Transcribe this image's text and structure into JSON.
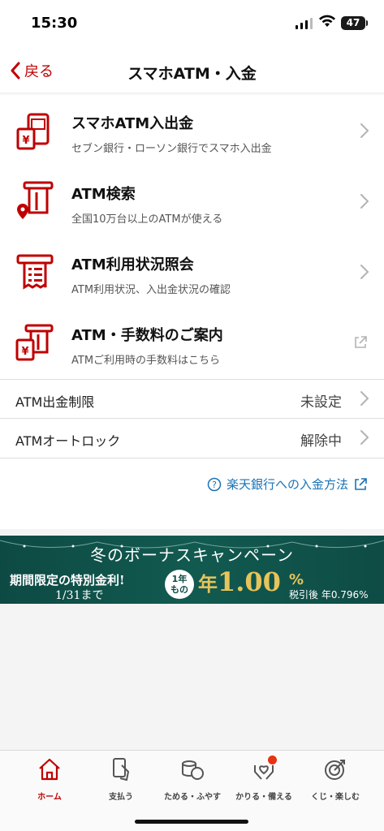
{
  "status_bar": {
    "time": "15:30",
    "battery": "47"
  },
  "nav": {
    "back_label": "戻る",
    "title": "スマホATM・入金"
  },
  "menu": [
    {
      "title": "スマホATM入出金",
      "subtitle": "セブン銀行・ローソン銀行でスマホ入出金",
      "icon": "smartphone-atm-icon",
      "trailing": "chevron"
    },
    {
      "title": "ATM検索",
      "subtitle": "全国10万台以上のATMが使える",
      "icon": "atm-location-icon",
      "trailing": "chevron"
    },
    {
      "title": "ATM利用状況照会",
      "subtitle": "ATM利用状況、入出金状況の確認",
      "icon": "atm-receipt-icon",
      "trailing": "chevron"
    },
    {
      "title": "ATM・手数料のご案内",
      "subtitle": "ATMご利用時の手数料はこちら",
      "icon": "atm-yen-icon",
      "trailing": "external"
    }
  ],
  "settings": [
    {
      "label": "ATM出金制限",
      "value": "未設定"
    },
    {
      "label": "ATMオートロック",
      "value": "解除中"
    }
  ],
  "deposit_link": "楽天銀行への入金方法",
  "banner": {
    "title": "冬のボーナスキャンペーン",
    "left_line1": "期間限定の特別金利!",
    "left_line2": "1/31まで",
    "badge_line1": "1年",
    "badge_line2": "もの",
    "rate_prefix": "年",
    "rate_value": "1.00",
    "rate_pct": "%",
    "net_rate": "税引後 年0.796%"
  },
  "tabs": [
    {
      "label": "ホーム",
      "icon": "home-icon",
      "active": true
    },
    {
      "label": "支払う",
      "icon": "card-payment-icon",
      "active": false
    },
    {
      "label": "ためる・ふやす",
      "icon": "coins-icon",
      "active": false
    },
    {
      "label": "かりる・備える",
      "icon": "hands-heart-icon",
      "active": false,
      "badge": true
    },
    {
      "label": "くじ・楽しむ",
      "icon": "target-icon",
      "active": false
    }
  ],
  "colors": {
    "brand": "#bf0000",
    "link": "#1a73b5",
    "banner_bg": "#0d4a44",
    "banner_gold": "#e7c45a"
  }
}
